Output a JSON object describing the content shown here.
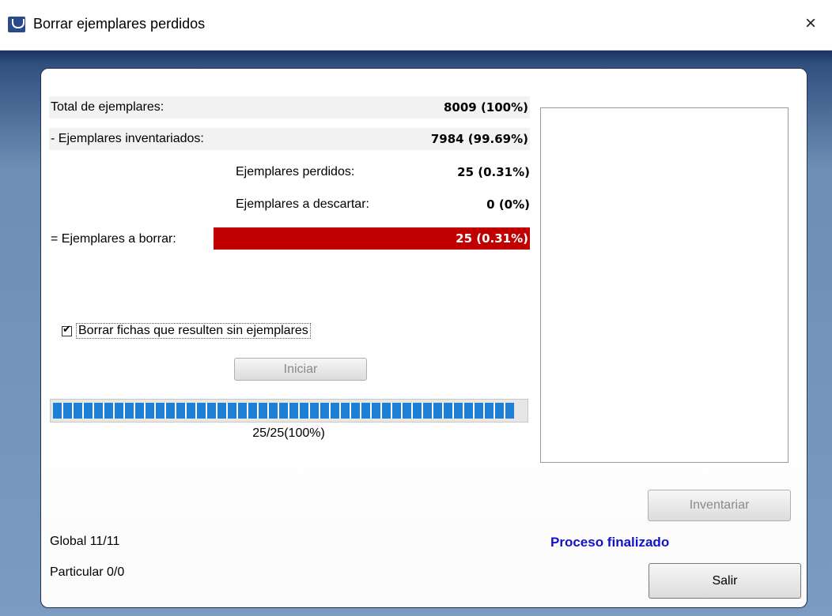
{
  "window": {
    "title": "Borrar ejemplares perdidos",
    "close_icon": "×"
  },
  "summary": {
    "total_label": "Total de ejemplares:",
    "total_value": "8009 (100%)",
    "inventoried_label": "- Ejemplares inventariados:",
    "inventoried_value": "7984 (99.69%)",
    "lost_label": "Ejemplares perdidos:",
    "lost_value": "25 (0.31%)",
    "discard_label": "Ejemplares a descartar:",
    "discard_value": "0 (0%)",
    "delete_label": "= Ejemplares a borrar:",
    "delete_value": "25 (0.31%)",
    "delete_bar_color": "#c00000"
  },
  "options": {
    "delete_records_label": "Borrar fichas que resulten sin ejemplares",
    "delete_records_checked": true
  },
  "buttons": {
    "start": "Iniciar",
    "inventory": "Inventariar",
    "exit": "Salir"
  },
  "progress": {
    "text": "25/25(100%)",
    "fraction": 1.0,
    "color": "#1e7fd6"
  },
  "status": {
    "text": "Proceso finalizado",
    "color": "#1212c8"
  },
  "footer": {
    "global": "Global  11/11",
    "particular": "Particular 0/0"
  }
}
